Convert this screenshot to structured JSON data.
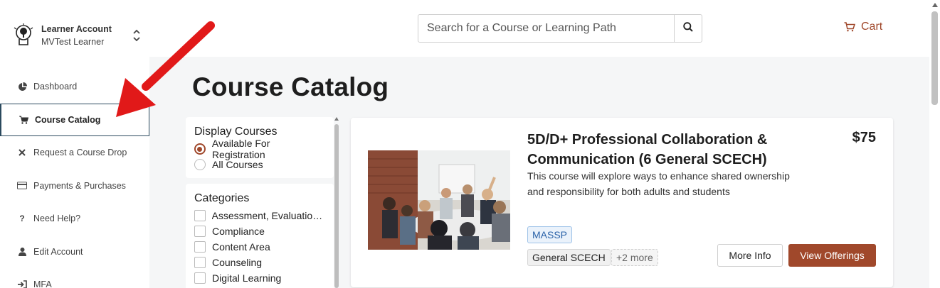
{
  "account": {
    "title": "Learner Account",
    "subtitle": "MVTest Learner"
  },
  "sidebar": {
    "items": [
      {
        "label": "Dashboard",
        "icon": "pie-chart-icon"
      },
      {
        "label": "Course Catalog",
        "icon": "cart-icon",
        "active": true
      },
      {
        "label": "Request a Course Drop",
        "icon": "x-icon"
      },
      {
        "label": "Payments & Purchases",
        "icon": "credit-card-icon"
      },
      {
        "label": "Need Help?",
        "icon": "question-icon"
      },
      {
        "label": "Edit Account",
        "icon": "user-icon"
      },
      {
        "label": "MFA",
        "icon": "sign-in-icon"
      }
    ]
  },
  "header": {
    "search_placeholder": "Search for a Course or Learning Path",
    "cart_label": "Cart"
  },
  "main": {
    "title": "Course Catalog",
    "display_courses": {
      "heading": "Display Courses",
      "options": [
        {
          "label": "Available For Registration",
          "checked": true
        },
        {
          "label": "All Courses",
          "checked": false
        }
      ]
    },
    "categories": {
      "heading": "Categories",
      "items": [
        "Assessment, Evaluation ...",
        "Compliance",
        "Content Area",
        "Counseling",
        "Digital Learning"
      ]
    },
    "course": {
      "title": "5D/D+ Professional Collaboration & Communication (6 General SCECH)",
      "price": "$75",
      "description": "This course will explore ways to enhance shared ownership and responsibility for both adults and students",
      "tags": [
        "MASSP",
        "General SCECH"
      ],
      "more_tags": "+2 more",
      "more_info_label": "More Info",
      "view_offerings_label": "View Offerings"
    }
  },
  "colors": {
    "accent": "#a0482b",
    "arrow": "#e11919",
    "massp_tag": "#2a62a8"
  }
}
